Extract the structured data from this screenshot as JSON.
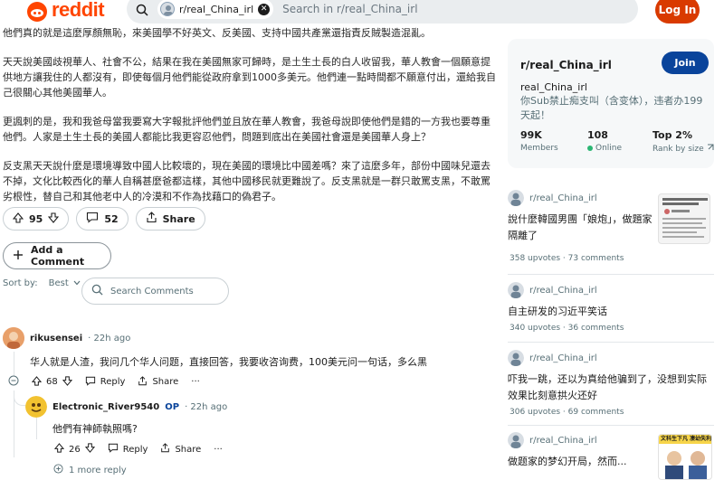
{
  "header": {
    "logo_text": "reddit",
    "search_chip": "r/real_China_irl",
    "search_placeholder": "Search in r/real_China_irl",
    "login_label": "Log In"
  },
  "post": {
    "paragraphs": [
      "他們真的就是這麼厚顏無恥，來美國學不好英文、反美國、支持中國共產黨還指責反賊製造混亂。",
      "天天說美國歧視華人、社會不公，結果在我在美國無家可歸時，是土生土長的白人收留我，華人教會一個願意提供地方讓我住的人都沒有，即使每個月他們能從政府拿到1000多美元。他們連一點時間都不願意付出，還給我自己很關心其他美國華人。",
      "更諷刺的是，我和我爸母當我要寫大字報批評他們並且放在華人教會，我爸母說即使他們是錯的一方我也要尊重他們。人家是土生土長的美國人都能比我更容忍他們，問題到底出在美國社會還是美國華人身上？",
      "反支黑天天說什麼是環境導致中國人比較壞的，現在美國的環境比中國差嗎？來了這麼多年，部份中國味兒還去不掉，文化比較西化的華人自稱甚麼爸都這樣，其他中國移民就更難說了。反支黑就是一群只敢罵支黑，不敢罵劣根性，替自己和其他老中人的冷漠和不作為找藉口的偽君子。"
    ],
    "upvotes": "95",
    "comments": "52",
    "share_label": "Share"
  },
  "add_comment_label": "Add a Comment",
  "sort": {
    "label": "Sort by:",
    "value": "Best",
    "search_placeholder": "Search Comments"
  },
  "comments": [
    {
      "author": "rikusensei",
      "time": "· 22h ago",
      "text": "华人就是人渣，我问几个华人问题，直接回答，我要收咨询费，100美元问一句话，多么黑",
      "votes": "68",
      "reply_label": "Reply",
      "share_label": "Share",
      "more_icon": "···"
    },
    {
      "author": "Electronic_River9540",
      "op": "OP",
      "time": "· 22h ago",
      "text": "他們有神師執照嗎?",
      "votes": "26",
      "reply_label": "Reply",
      "share_label": "Share",
      "more_icon": "···"
    }
  ],
  "more_reply": "1 more reply",
  "sidebar": {
    "title": "r/real_China_irl",
    "join_label": "Join",
    "name": "real_China_irl",
    "description": "你Sub禁止痴支叫（含变体），违者办199天起！",
    "stats": [
      {
        "value": "99K",
        "label": "Members"
      },
      {
        "value": "108",
        "label": "Online"
      },
      {
        "value": "Top 2%",
        "label": "Rank by size"
      }
    ]
  },
  "related": [
    {
      "sub": "r/real_China_irl",
      "title": "說什麼韓國男團「娘炮」，做題家隔離了",
      "upvotes": "358 upvotes",
      "comments": "73 comments"
    },
    {
      "sub": "r/real_China_irl",
      "title": "自主研发的习近平笑话",
      "upvotes": "340 upvotes",
      "comments": "36 comments"
    },
    {
      "sub": "r/real_China_irl",
      "title": "吓我一跳，还以为真给他骗到了，没想到实际效果比刻意拱火还好",
      "upvotes": "306 upvotes",
      "comments": "69 comments"
    },
    {
      "sub": "r/real_China_irl",
      "title": "做题家的梦幻开局，然而...",
      "thumb_text": "文科生下凡 凄幼失利"
    }
  ]
}
